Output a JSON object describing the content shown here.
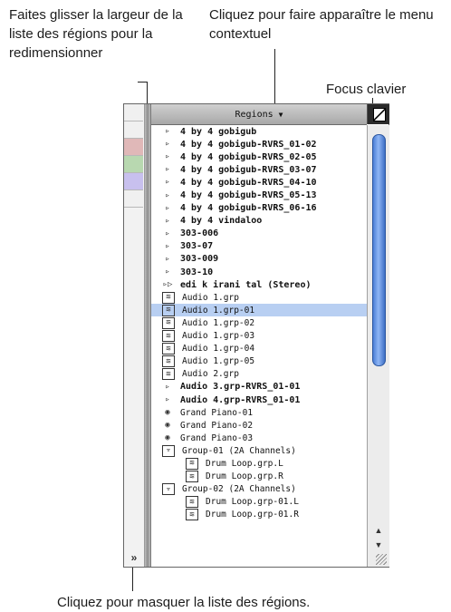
{
  "callouts": {
    "drag_width": "Faites glisser la largeur de la liste des régions pour la redimensionner",
    "context_menu": "Cliquez pour faire apparaître le menu contextuel",
    "keyboard_focus": "Focus clavier",
    "hide_list": "Cliquez pour masquer la liste des régions."
  },
  "panel": {
    "title": "Regions",
    "caret": "▼",
    "hide_toggle": "»"
  },
  "track_colors": [
    "#f0f0f0",
    "#f0f0f0",
    "#e0b8b8",
    "#b8d8b0",
    "#c8c0ee",
    "#f0f0f0"
  ],
  "regions": [
    {
      "label": "4 by 4 gobigub",
      "icon": "midi",
      "style": "bold"
    },
    {
      "label": "4 by 4 gobigub-RVRS_01-02",
      "icon": "midi",
      "style": "bold"
    },
    {
      "label": "4 by 4 gobigub-RVRS_02-05",
      "icon": "midi",
      "style": "bold"
    },
    {
      "label": "4 by 4 gobigub-RVRS_03-07",
      "icon": "midi",
      "style": "bold"
    },
    {
      "label": "4 by 4 gobigub-RVRS_04-10",
      "icon": "midi",
      "style": "bold"
    },
    {
      "label": "4 by 4 gobigub-RVRS_05-13",
      "icon": "midi",
      "style": "bold"
    },
    {
      "label": "4 by 4 gobigub-RVRS_06-16",
      "icon": "midi",
      "style": "bold"
    },
    {
      "label": "4 by 4 vindaloo",
      "icon": "midi",
      "style": "bold"
    },
    {
      "label": "303-006",
      "icon": "midi",
      "style": "bold"
    },
    {
      "label": "303-07",
      "icon": "midi",
      "style": "bold"
    },
    {
      "label": "303-009",
      "icon": "midi",
      "style": "bold"
    },
    {
      "label": "303-10",
      "icon": "midi",
      "style": "bold"
    },
    {
      "label": "edi k irani tal (Stereo)",
      "icon": "stereo",
      "style": "bold"
    },
    {
      "label": "Audio 1.grp",
      "icon": "wave",
      "style": "normal"
    },
    {
      "label": "Audio 1.grp-01",
      "icon": "wave",
      "style": "normal",
      "selected": true
    },
    {
      "label": "Audio 1.grp-02",
      "icon": "wave",
      "style": "normal"
    },
    {
      "label": "Audio 1.grp-03",
      "icon": "wave",
      "style": "normal"
    },
    {
      "label": "Audio 1.grp-04",
      "icon": "wave",
      "style": "normal"
    },
    {
      "label": "Audio 1.grp-05",
      "icon": "wave",
      "style": "normal"
    },
    {
      "label": "Audio 2.grp",
      "icon": "wave",
      "style": "normal"
    },
    {
      "label": "Audio 3.grp-RVRS_01-01",
      "icon": "midi",
      "style": "bold"
    },
    {
      "label": "Audio 4.grp-RVRS_01-01",
      "icon": "midi",
      "style": "bold"
    },
    {
      "label": "Grand Piano-01",
      "icon": "inst",
      "style": "normal"
    },
    {
      "label": "Grand Piano-02",
      "icon": "inst",
      "style": "normal"
    },
    {
      "label": "Grand Piano-03",
      "icon": "inst",
      "style": "normal"
    },
    {
      "label": "Group-01 (2A Channels)",
      "icon": "group",
      "style": "normal"
    },
    {
      "label": "Drum Loop.grp.L",
      "icon": "wave",
      "style": "normal",
      "indent": true
    },
    {
      "label": "Drum Loop.grp.R",
      "icon": "wave",
      "style": "normal",
      "indent": true
    },
    {
      "label": "Group-02 (2A Channels)",
      "icon": "group",
      "style": "normal"
    },
    {
      "label": "Drum Loop.grp-01.L",
      "icon": "wave",
      "style": "normal",
      "indent": true
    },
    {
      "label": "Drum Loop.grp-01.R",
      "icon": "wave",
      "style": "normal",
      "indent": true
    }
  ],
  "icons": {
    "midi": "▹",
    "stereo": "▹▷",
    "wave": "≋",
    "inst": "◉",
    "group": "▿"
  },
  "scrollbar": {
    "up": "▲",
    "down": "▼",
    "position": 0.0
  }
}
